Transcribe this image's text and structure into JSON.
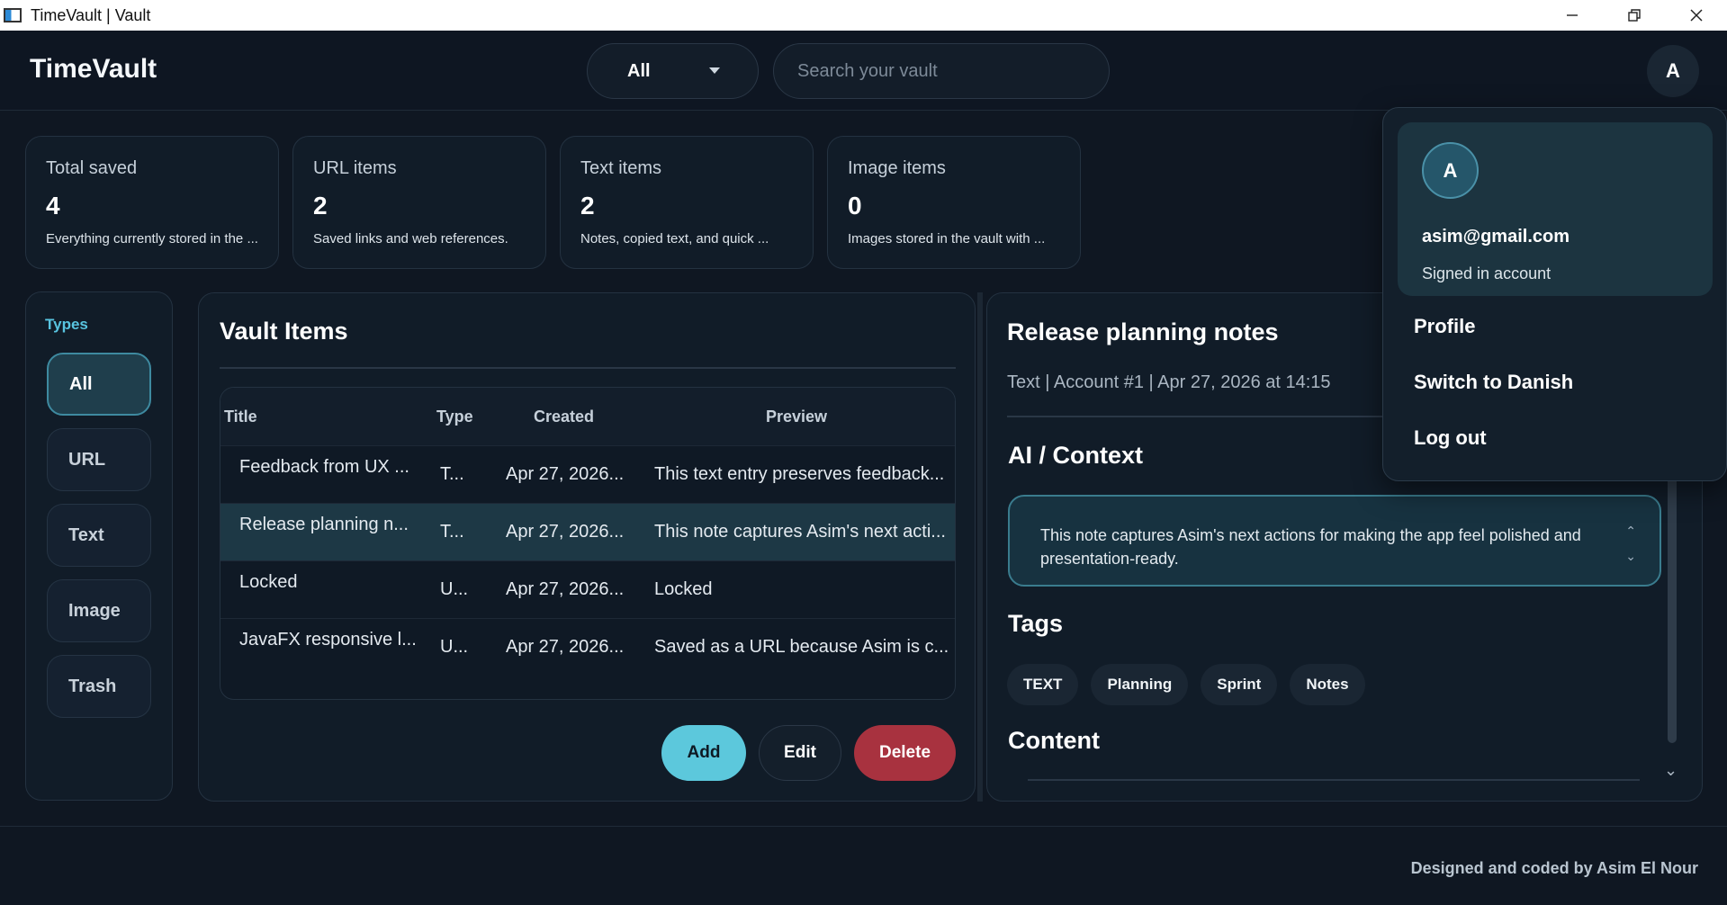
{
  "window": {
    "title": "TimeVault | Vault"
  },
  "header": {
    "brand": "TimeVault",
    "filter_value": "All",
    "search_placeholder": "Search your vault",
    "avatar_initial": "A"
  },
  "stats": [
    {
      "label": "Total saved",
      "value": "4",
      "desc": "Everything currently stored in the ..."
    },
    {
      "label": "URL items",
      "value": "2",
      "desc": "Saved links and web references."
    },
    {
      "label": "Text items",
      "value": "2",
      "desc": "Notes, copied text, and quick ..."
    },
    {
      "label": "Image items",
      "value": "0",
      "desc": "Images stored in the vault with ..."
    }
  ],
  "types": {
    "title": "Types",
    "items": [
      "All",
      "URL",
      "Text",
      "Image",
      "Trash"
    ],
    "active": "All"
  },
  "vault": {
    "title": "Vault Items",
    "columns": [
      "Title",
      "Type",
      "Created",
      "Preview"
    ],
    "rows": [
      {
        "title": "Feedback from UX ...",
        "type": "T...",
        "created": "Apr 27, 2026...",
        "preview": "This text entry preserves feedback..."
      },
      {
        "title": "Release planning n...",
        "type": "T...",
        "created": "Apr 27, 2026...",
        "preview": "This note captures Asim's next acti..."
      },
      {
        "title": "Locked",
        "type": "U...",
        "created": "Apr 27, 2026...",
        "preview": "Locked"
      },
      {
        "title": "JavaFX responsive l...",
        "type": "U...",
        "created": "Apr 27, 2026...",
        "preview": "Saved as a URL because Asim is c..."
      }
    ],
    "selected_row": 1,
    "buttons": {
      "add": "Add",
      "edit": "Edit",
      "delete": "Delete"
    }
  },
  "detail": {
    "title": "Release planning notes",
    "meta": "Text | Account #1 | Apr 27, 2026 at 14:15",
    "ai_heading": "AI / Context",
    "ai_text": "This note captures Asim's next actions for making the app feel polished and presentation-ready.",
    "tags_heading": "Tags",
    "tags": [
      "TEXT",
      "Planning",
      "Sprint",
      "Notes"
    ],
    "content_heading": "Content"
  },
  "profile_menu": {
    "initial": "A",
    "email": "asim@gmail.com",
    "status": "Signed in account",
    "items": [
      "Profile",
      "Switch to Danish",
      "Log out"
    ]
  },
  "footer": {
    "credit": "Designed and coded by Asim El Nour"
  },
  "colors": {
    "accent": "#5cc8dc",
    "danger": "#a8323f",
    "background": "#0f1722",
    "panel": "#111c28"
  }
}
